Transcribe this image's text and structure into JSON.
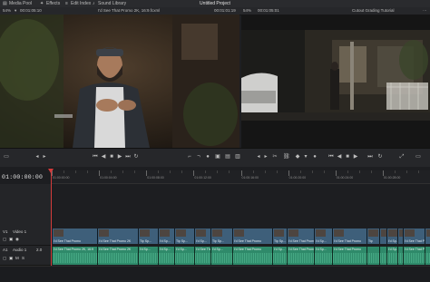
{
  "app": {
    "project_title": "Untitled Project"
  },
  "topbar": {
    "media_pool_label": "Media Pool",
    "effects_label": "Effects",
    "edit_index_label": "Edit Index",
    "sound_library_label": "Sound Library"
  },
  "source_viewer": {
    "zoom": "54%",
    "timecode": "00:01:05:10",
    "clip_name": "I'd See That Promo 2K, 16:9.fcxml",
    "duration": "00:01:01:19"
  },
  "program_viewer": {
    "zoom": "54%",
    "timecode": "00:01:05:01",
    "color_label": "Cutout Grading Tutorial"
  },
  "timeline": {
    "timecode": "01:00:00:00",
    "ruler_ticks": [
      "01:00:00:00",
      "01:00:04:00",
      "01:00:08:00",
      "01:00:12:00",
      "01:00:16:00",
      "01:00:20:00",
      "01:00:24:00",
      "01:00:28:00"
    ],
    "video_track": {
      "name": "Video 1",
      "short": "V1"
    },
    "audio_track": {
      "name": "Audio 1",
      "short": "A1",
      "level": "2.0"
    },
    "video_clips": [
      {
        "label": "I'd See That Promo"
      },
      {
        "label": "I'd See That Promo 2K"
      },
      {
        "label": "Tip Sp..."
      },
      {
        "label": "I'd Sp..."
      },
      {
        "label": "Tip Sp..."
      },
      {
        "label": "I'd Sp..."
      },
      {
        "label": "Tip Sp..."
      },
      {
        "label": "I'd See That Promo"
      },
      {
        "label": "Tip Sp..."
      },
      {
        "label": "I'd See That Promo"
      },
      {
        "label": "I'd Sp..."
      },
      {
        "label": "I'd See That Promo"
      },
      {
        "label": "Tip"
      },
      {
        "label": ""
      },
      {
        "label": "I'd Sp..."
      },
      {
        "label": ""
      },
      {
        "label": "I'd See That Promo"
      },
      {
        "label": ""
      },
      {
        "label": "Tip Sp..."
      }
    ],
    "audio_clips": [
      {
        "label": "I'd See That Promo 2K, 16:9"
      },
      {
        "label": "I'd See That Promo 2K"
      },
      {
        "label": "I'd Sp..."
      },
      {
        "label": "I'd Sp..."
      },
      {
        "label": "I'd Sp..."
      },
      {
        "label": "I'd See That Promo"
      },
      {
        "label": "I'd Sp..."
      },
      {
        "label": "I'd See That Promo"
      },
      {
        "label": "I'd Sp..."
      },
      {
        "label": "I'd See That Promo"
      },
      {
        "label": "I'd Sp..."
      },
      {
        "label": "I'd See That Promo"
      },
      {
        "label": ""
      },
      {
        "label": ""
      },
      {
        "label": "I'd Sp..."
      },
      {
        "label": ""
      },
      {
        "label": "I'd See That Promo"
      },
      {
        "label": ""
      },
      {
        "label": "I'd Sp..."
      }
    ]
  },
  "colors": {
    "playhead": "#d43b3b",
    "video_clip": "#3e5f7a",
    "audio_clip": "#2f8a6a",
    "panel": "#26272a",
    "background": "#1e1f22"
  }
}
